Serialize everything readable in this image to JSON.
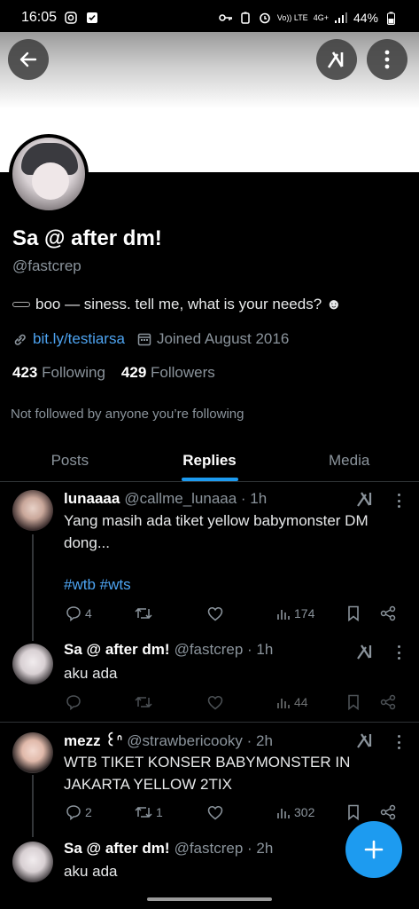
{
  "status_bar": {
    "time": "16:05",
    "battery": "44%",
    "network": "4G+",
    "volte": "Vo)) LTE"
  },
  "profile": {
    "display_name": "Sa @ after dm!",
    "handle": "@fastcrep",
    "bio": "boo — siness. tell me, what is your needs? ☻",
    "link": "bit.ly/testiarsa",
    "joined": "Joined August 2016",
    "following_count": "423",
    "following_label": "Following",
    "followers_count": "429",
    "followers_label": "Followers",
    "not_followed": "Not followed by anyone you’re following"
  },
  "tabs": [
    {
      "label": "Posts"
    },
    {
      "label": "Replies"
    },
    {
      "label": "Media"
    }
  ],
  "posts": [
    {
      "name": "lunaaaa",
      "handle": "@callme_lunaaa · 1h",
      "text": "Yang masih ada tiket yellow babymonster DM dong...",
      "hashtags": "#wtb #wts",
      "replies": "4",
      "reposts": "",
      "likes": "",
      "views": "174"
    },
    {
      "name": "Sa @ after dm!",
      "handle": "@fastcrep · 1h",
      "text": "aku ada",
      "replies": "",
      "reposts": "",
      "likes": "",
      "views": "44"
    },
    {
      "name": "mezz ꒰ᐢ",
      "handle": "@strawbericooky · 2h",
      "text": "WTB TIKET KONSER BABYMONSTER IN JAKARTA YELLOW 2TIX",
      "replies": "2",
      "reposts": "1",
      "likes": "",
      "views": "302"
    },
    {
      "name": "Sa @ after dm!",
      "handle": "@fastcrep · 2h",
      "text": "aku ada"
    }
  ],
  "colors": {
    "accent": "#1d9bf0",
    "link": "#4da3f0",
    "muted": "#8b949c",
    "background": "#000000"
  },
  "icons": [
    "back-arrow-icon",
    "grok-icon",
    "more-vertical-icon",
    "link-icon",
    "calendar-icon",
    "reply-icon",
    "repost-icon",
    "like-icon",
    "views-icon",
    "bookmark-icon",
    "share-icon",
    "compose-plus-icon"
  ]
}
